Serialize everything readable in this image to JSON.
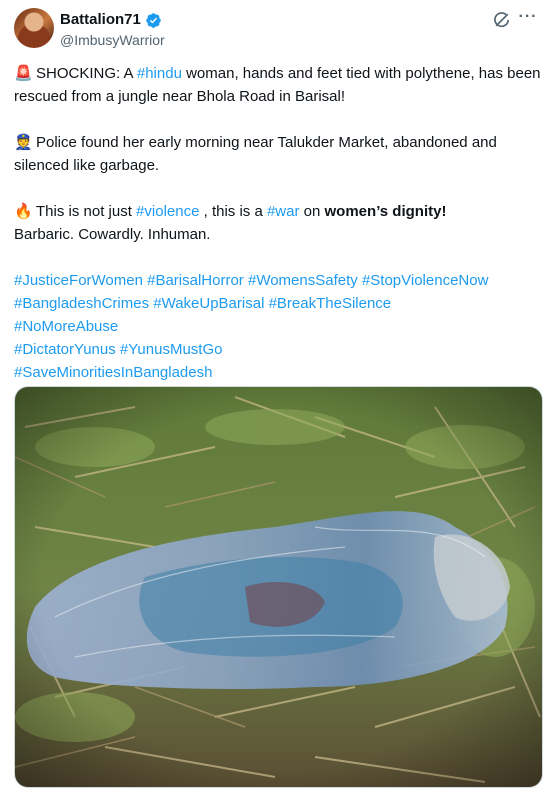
{
  "author": {
    "display_name": "Battalion71",
    "handle": "@ImbusyWarrior",
    "verified_badge_icon": "verified-badge-icon",
    "avatar_icon": "profile-avatar"
  },
  "actions": {
    "grok_icon": "grok-icon",
    "more_icon": "more-options-icon",
    "more_label": "···"
  },
  "post": {
    "p1": {
      "emoji": "🚨",
      "t1": "SHOCKING: A ",
      "tag": "#hindu",
      "t2": " woman, hands and feet tied with polythene, has been rescued from a jungle near Bhola Road in Barisal!"
    },
    "p2": {
      "emoji": "👮",
      "text": "Police found her early morning near Talukder Market, abandoned and silenced like garbage."
    },
    "p3": {
      "emoji": "🔥",
      "t1": "This is not just ",
      "tag1": "#violence",
      "t2": " , this is a ",
      "tag2": "#war",
      "t3": " on ",
      "bold": "women’s dignity!",
      "line2": "Barbaric. Cowardly. Inhuman."
    },
    "hashtags": [
      "#JusticeForWomen",
      "#BarisalHorror",
      "#WomensSafety",
      "#StopViolenceNow",
      "#BangladeshCrimes",
      "#WakeUpBarisal",
      "#BreakTheSilence",
      "#NoMoreAbuse",
      "#DictatorYunus",
      "#YunusMustGo",
      "#SaveMinoritiesInBangladesh"
    ]
  },
  "media": {
    "description_icon": "attached-photo"
  }
}
